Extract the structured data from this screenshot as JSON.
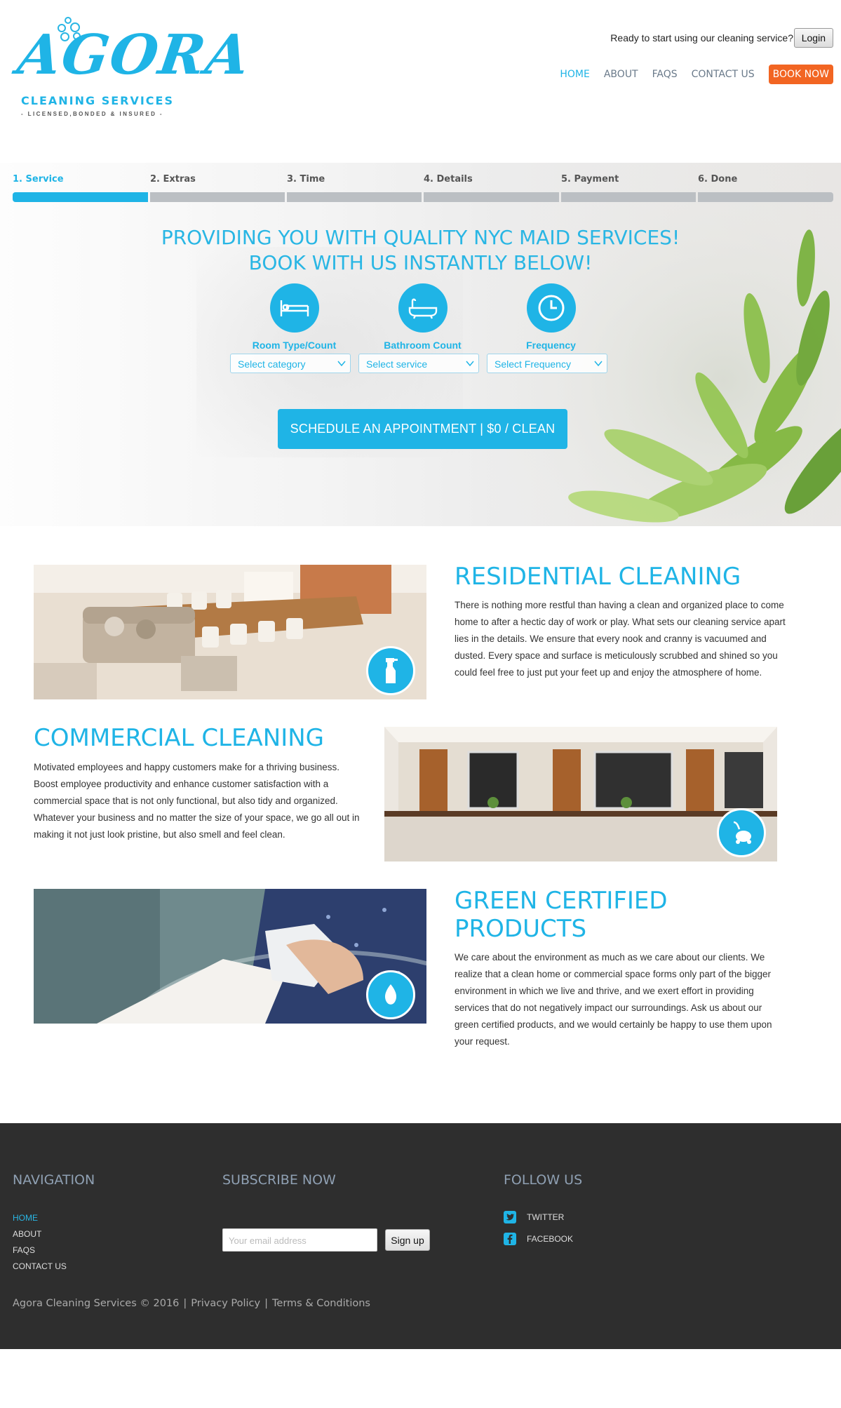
{
  "brand": {
    "logo_text": "AGORA",
    "subtitle": "CLEANING SERVICES",
    "tagline": "- LICENSED,BONDED & INSURED -"
  },
  "header": {
    "ready_text": "Ready to start using our cleaning service?",
    "login_label": "Login",
    "nav": [
      {
        "label": "HOME",
        "active": true
      },
      {
        "label": "ABOUT",
        "active": false
      },
      {
        "label": "FAQS",
        "active": false
      },
      {
        "label": "CONTACT US",
        "active": false
      }
    ],
    "book_now_label": "BOOK NOW"
  },
  "booking": {
    "steps": [
      {
        "label": "1. Service",
        "active": true
      },
      {
        "label": "2. Extras",
        "active": false
      },
      {
        "label": "3. Time",
        "active": false
      },
      {
        "label": "4. Details",
        "active": false
      },
      {
        "label": "5. Payment",
        "active": false
      },
      {
        "label": "6. Done",
        "active": false
      }
    ],
    "title_line1": "PROVIDING YOU WITH QUALITY NYC MAID SERVICES!",
    "title_line2": "BOOK WITH US INSTANTLY BELOW!",
    "options": [
      {
        "label": "Room Type/Count",
        "icon": "bed-icon",
        "select_value": "Select category"
      },
      {
        "label": "Bathroom Count",
        "icon": "bathtub-icon",
        "select_value": "Select service"
      },
      {
        "label": "Frequency",
        "icon": "clock-icon",
        "select_value": "Select Frequency"
      }
    ],
    "schedule_label": "SCHEDULE AN APPOINTMENT | $0 / CLEAN"
  },
  "services": [
    {
      "title": "RESIDENTIAL CLEANING",
      "text": "There is nothing more restful than having a clean and organized place to come home to after a hectic day of work or play. What sets our cleaning service apart lies in the details. We ensure that every nook and cranny is vacuumed and dusted. Every space and surface is meticulously scrubbed and shined so you could feel free to just put your feet up and enjoy the atmosphere of home.",
      "badge_icon": "spray-bottle-icon"
    },
    {
      "title": "COMMERCIAL CLEANING",
      "text": "Motivated employees and happy customers make for a thriving business. Boost employee productivity and enhance customer satisfaction with a commercial space that is not only functional, but also tidy and organized. Whatever your business and no matter the size of your space, we go all out in making it not just look pristine, but also smell and feel clean.",
      "badge_icon": "vacuum-icon"
    },
    {
      "title_line1": "GREEN CERTIFIED",
      "title_line2": "PRODUCTS",
      "text": "We care about the environment as much as we care about our clients. We realize that a clean home or commercial space forms only part of the bigger environment in which we live and thrive, and we exert effort in providing services that do not negatively impact our surroundings. Ask us about our green certified products, and we would certainly be happy to use them upon your request.",
      "badge_icon": "leaf-icon"
    }
  ],
  "footer": {
    "navigation_heading": "NAVIGATION",
    "nav_links": [
      "HOME",
      "ABOUT",
      "FAQS",
      "CONTACT US"
    ],
    "subscribe_heading": "SUBSCRIBE NOW",
    "email_placeholder": "Your email address",
    "signup_label": "Sign up",
    "follow_heading": "FOLLOW US",
    "social": [
      {
        "label": "TWITTER",
        "icon": "twitter-icon"
      },
      {
        "label": "FACEBOOK",
        "icon": "facebook-icon"
      }
    ],
    "copyright": "Agora Cleaning Services © 2016",
    "privacy_label": "Privacy Policy",
    "terms_label": "Terms & Conditions",
    "separator": "|"
  },
  "colors": {
    "accent": "#1fb4e6",
    "book_now": "#f26522",
    "footer_bg": "#2e2e2e"
  }
}
